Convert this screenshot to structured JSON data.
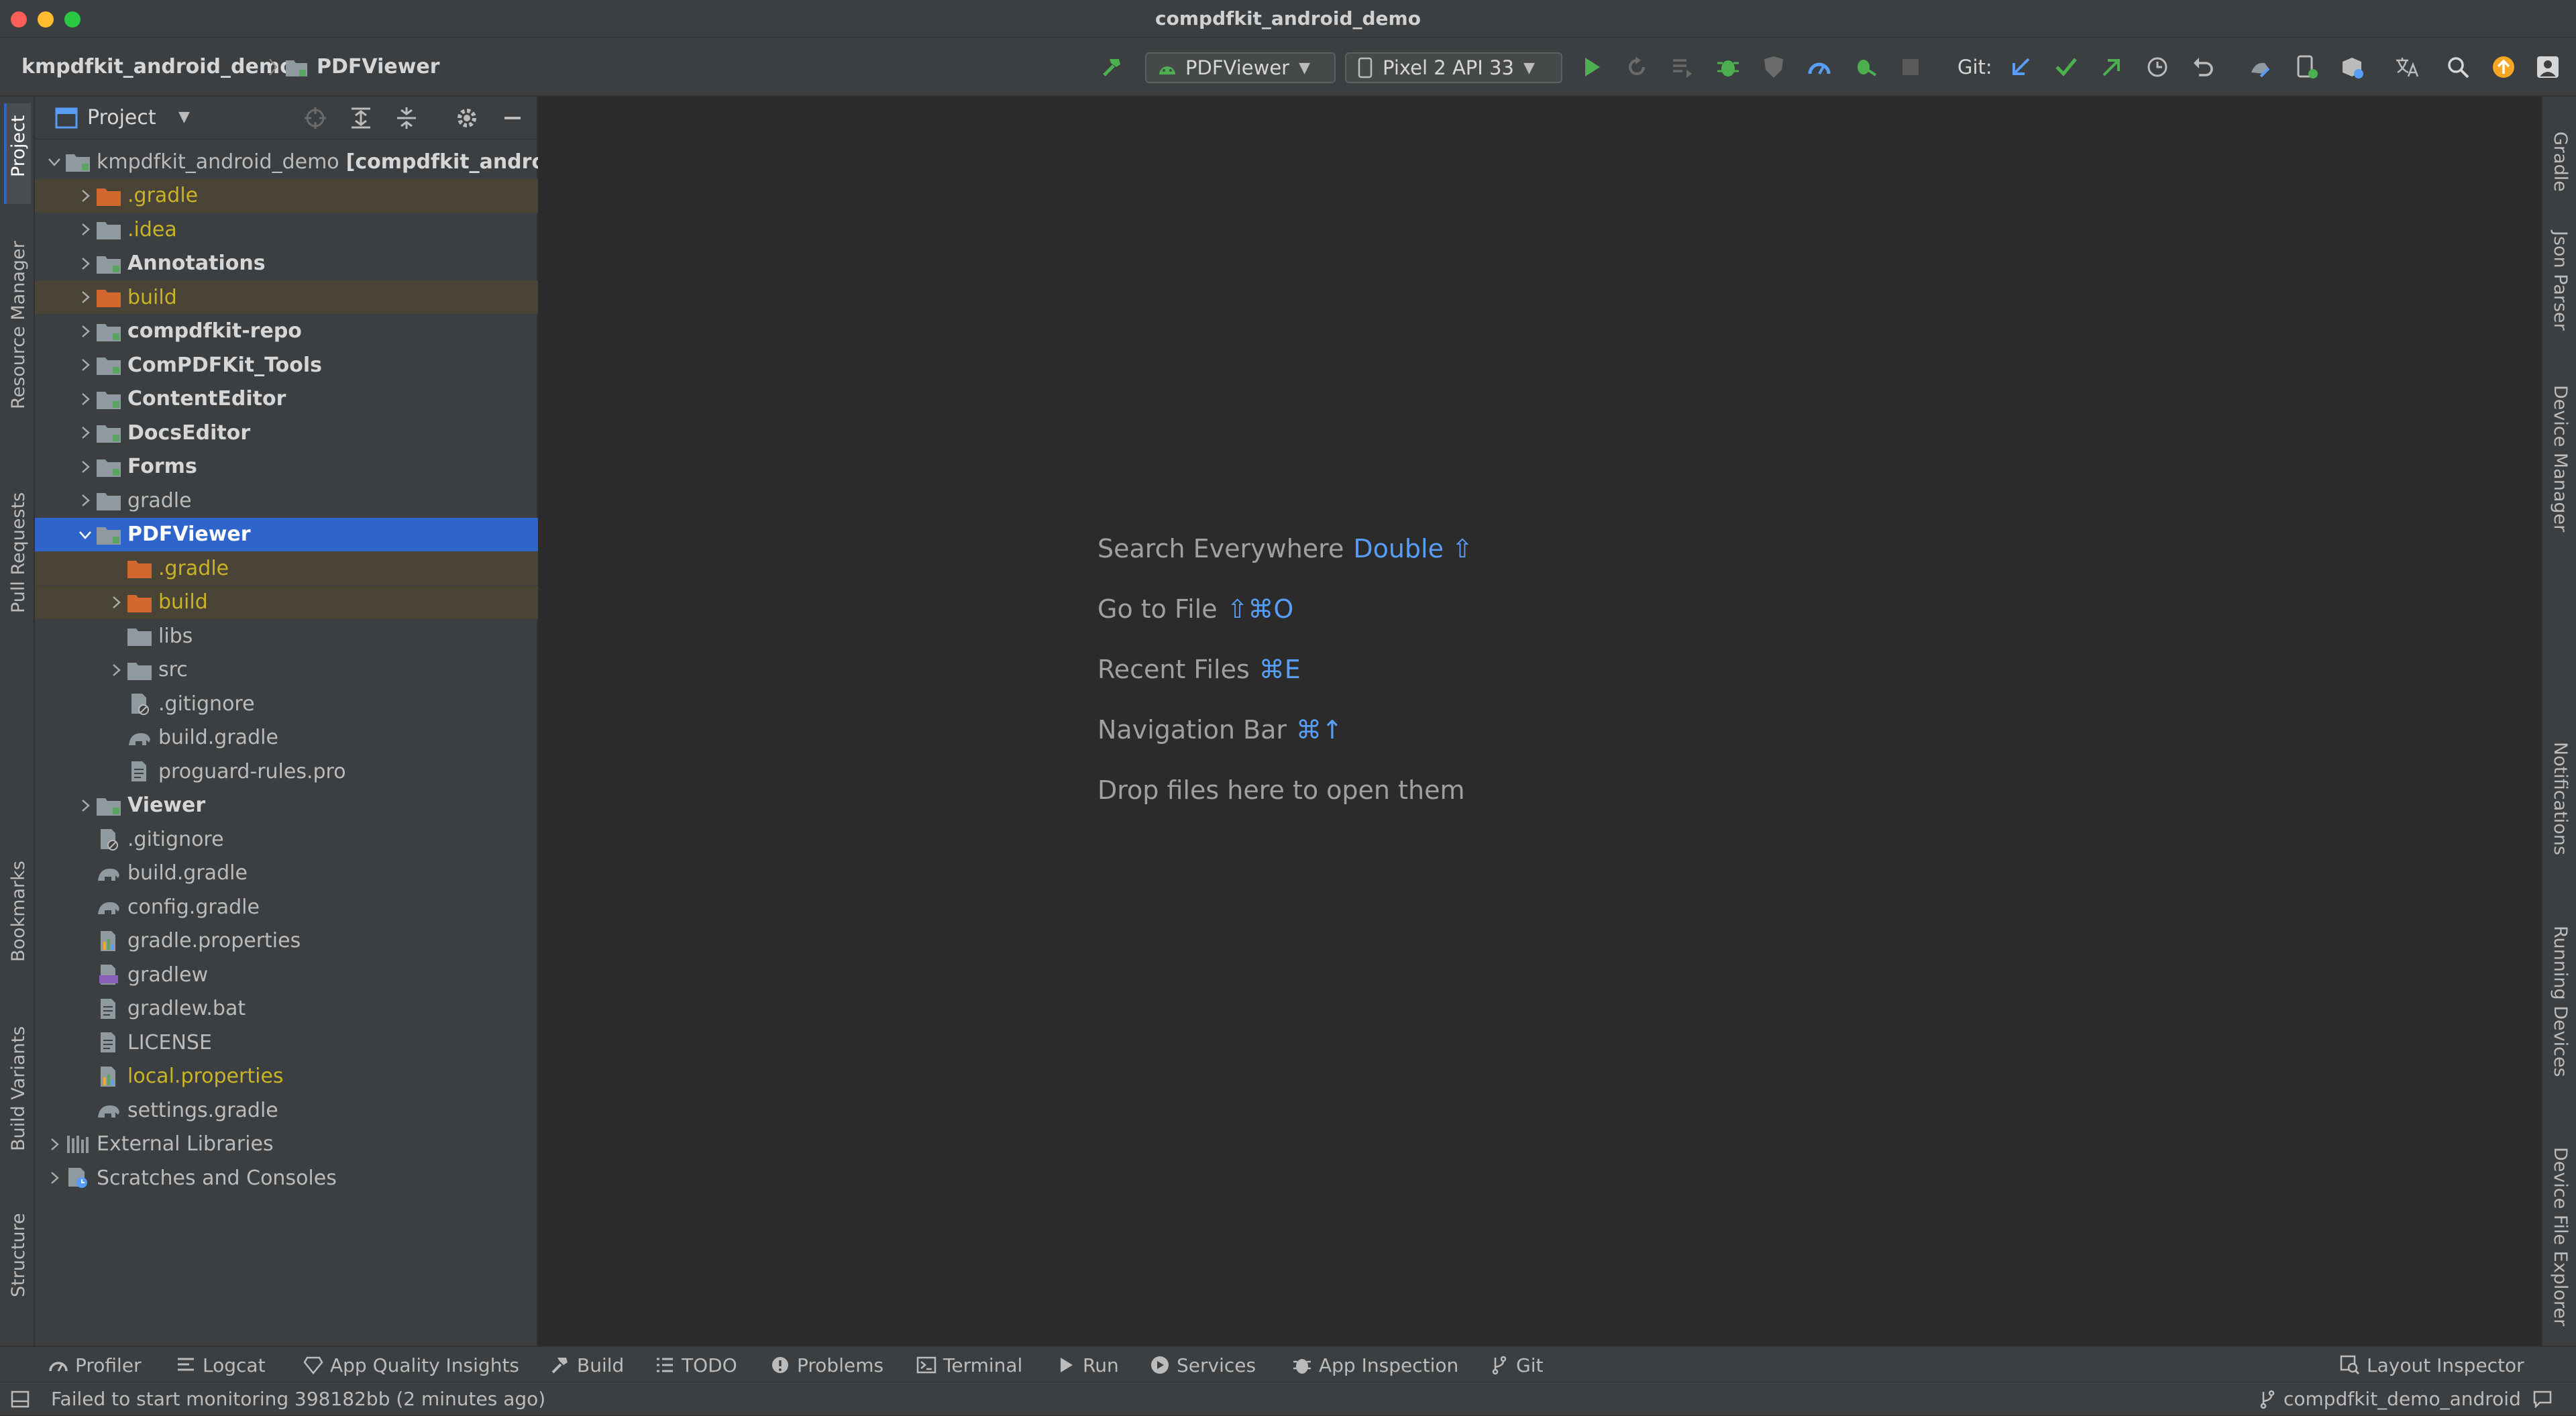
{
  "window": {
    "title": "compdfkit_android_demo"
  },
  "breadcrumb": {
    "project": "kmpdfkit_android_demo",
    "module": "PDFViewer"
  },
  "toolbar": {
    "run_config": "PDFViewer",
    "device": "Pixel 2 API 33",
    "git_label": "Git:"
  },
  "left_tabs": [
    "Project",
    "Resource Manager",
    "Pull Requests",
    "Bookmarks",
    "Build Variants",
    "Structure"
  ],
  "right_tabs": [
    "Gradle",
    "Json Parser",
    "Device Manager",
    "Notifications",
    "Running Devices",
    "Device File Explorer"
  ],
  "project_panel": {
    "title": "Project",
    "tree": [
      {
        "label": "kmpdfkit_android_demo",
        "extra": "[compdfkit_android_demo]",
        "depth": 0,
        "expanded": true,
        "icon": "module-folder-icon"
      },
      {
        "label": ".gradle",
        "depth": 1,
        "chevron": true,
        "icon": "excluded-folder-icon",
        "style": "excluded"
      },
      {
        "label": ".idea",
        "depth": 1,
        "chevron": true,
        "icon": "folder-icon",
        "style": "excluded-plain"
      },
      {
        "label": "Annotations",
        "depth": 1,
        "chevron": true,
        "icon": "module-folder-icon",
        "style": "bold"
      },
      {
        "label": "build",
        "depth": 1,
        "chevron": true,
        "icon": "excluded-folder-icon",
        "style": "excluded"
      },
      {
        "label": "compdfkit-repo",
        "depth": 1,
        "chevron": true,
        "icon": "module-folder-icon",
        "style": "bold"
      },
      {
        "label": "ComPDFKit_Tools",
        "depth": 1,
        "chevron": true,
        "icon": "module-folder-icon",
        "style": "bold"
      },
      {
        "label": "ContentEditor",
        "depth": 1,
        "chevron": true,
        "icon": "module-folder-icon",
        "style": "bold"
      },
      {
        "label": "DocsEditor",
        "depth": 1,
        "chevron": true,
        "icon": "module-folder-icon",
        "style": "bold"
      },
      {
        "label": "Forms",
        "depth": 1,
        "chevron": true,
        "icon": "module-folder-icon",
        "style": "bold"
      },
      {
        "label": "gradle",
        "depth": 1,
        "chevron": true,
        "icon": "folder-icon",
        "style": "plain"
      },
      {
        "label": "PDFViewer",
        "depth": 1,
        "expanded": true,
        "icon": "module-folder-icon",
        "style": "selected"
      },
      {
        "label": ".gradle",
        "depth": 2,
        "icon": "excluded-folder-icon",
        "style": "excluded"
      },
      {
        "label": "build",
        "depth": 2,
        "chevron": true,
        "icon": "excluded-folder-icon",
        "style": "excluded"
      },
      {
        "label": "libs",
        "depth": 2,
        "icon": "folder-icon",
        "style": "plain"
      },
      {
        "label": "src",
        "depth": 2,
        "chevron": true,
        "icon": "folder-icon",
        "style": "plain"
      },
      {
        "label": ".gitignore",
        "depth": 2,
        "icon": "gitignore-file-icon",
        "style": "plain"
      },
      {
        "label": "build.gradle",
        "depth": 2,
        "icon": "gradle-elephant-icon",
        "style": "plain"
      },
      {
        "label": "proguard-rules.pro",
        "depth": 2,
        "icon": "text-file-icon",
        "style": "plain"
      },
      {
        "label": "Viewer",
        "depth": 1,
        "chevron": true,
        "icon": "module-folder-icon",
        "style": "bold"
      },
      {
        "label": ".gitignore",
        "depth": 1,
        "icon": "gitignore-file-icon",
        "style": "plain"
      },
      {
        "label": "build.gradle",
        "depth": 1,
        "icon": "gradle-elephant-icon",
        "style": "plain"
      },
      {
        "label": "config.gradle",
        "depth": 1,
        "icon": "gradle-elephant-icon",
        "style": "plain"
      },
      {
        "label": "gradle.properties",
        "depth": 1,
        "icon": "properties-file-icon",
        "style": "plain"
      },
      {
        "label": "gradlew",
        "depth": 1,
        "icon": "shell-script-icon",
        "style": "plain"
      },
      {
        "label": "gradlew.bat",
        "depth": 1,
        "icon": "text-file-icon",
        "style": "plain"
      },
      {
        "label": "LICENSE",
        "depth": 1,
        "icon": "text-file-icon",
        "style": "plain"
      },
      {
        "label": "local.properties",
        "depth": 1,
        "icon": "properties-file-icon",
        "style": "excluded-plain"
      },
      {
        "label": "settings.gradle",
        "depth": 1,
        "icon": "gradle-elephant-icon",
        "style": "plain"
      },
      {
        "label": "External Libraries",
        "depth": 0,
        "chevron": true,
        "icon": "library-icon",
        "style": "plain"
      },
      {
        "label": "Scratches and Consoles",
        "depth": 0,
        "chevron": true,
        "icon": "scratches-icon",
        "style": "plain"
      }
    ]
  },
  "editor_hints": [
    {
      "label": "Search Everywhere",
      "shortcut": "Double ⇧"
    },
    {
      "label": "Go to File",
      "shortcut": "⇧⌘O"
    },
    {
      "label": "Recent Files",
      "shortcut": "⌘E"
    },
    {
      "label": "Navigation Bar",
      "shortcut": "⌘↑"
    },
    {
      "label": "Drop files here to open them",
      "shortcut": ""
    }
  ],
  "bottom_tabs": [
    {
      "label": "Profiler",
      "icon": "profiler-icon"
    },
    {
      "label": "Logcat",
      "icon": "logcat-icon"
    },
    {
      "label": "App Quality Insights",
      "icon": "diamond-icon"
    },
    {
      "label": "Build",
      "icon": "hammer-icon"
    },
    {
      "label": "TODO",
      "icon": "list-icon"
    },
    {
      "label": "Problems",
      "icon": "problems-icon"
    },
    {
      "label": "Terminal",
      "icon": "terminal-icon"
    },
    {
      "label": "Run",
      "icon": "run-icon"
    },
    {
      "label": "Services",
      "icon": "services-icon"
    },
    {
      "label": "App Inspection",
      "icon": "app-inspection-icon"
    },
    {
      "label": "Git",
      "icon": "git-branch-icon"
    }
  ],
  "layout_inspector": {
    "label": "Layout Inspector"
  },
  "status": {
    "message": "Failed to start monitoring 398182bb (2 minutes ago)",
    "branch": "compdfkit_demo_android"
  },
  "colors": {
    "background": "#2b2b2b",
    "panel": "#3c3f41",
    "selection": "#2f65ca",
    "excluded_text": "#c8b424",
    "shortcut": "#589df6",
    "run_green": "#4caf50"
  }
}
